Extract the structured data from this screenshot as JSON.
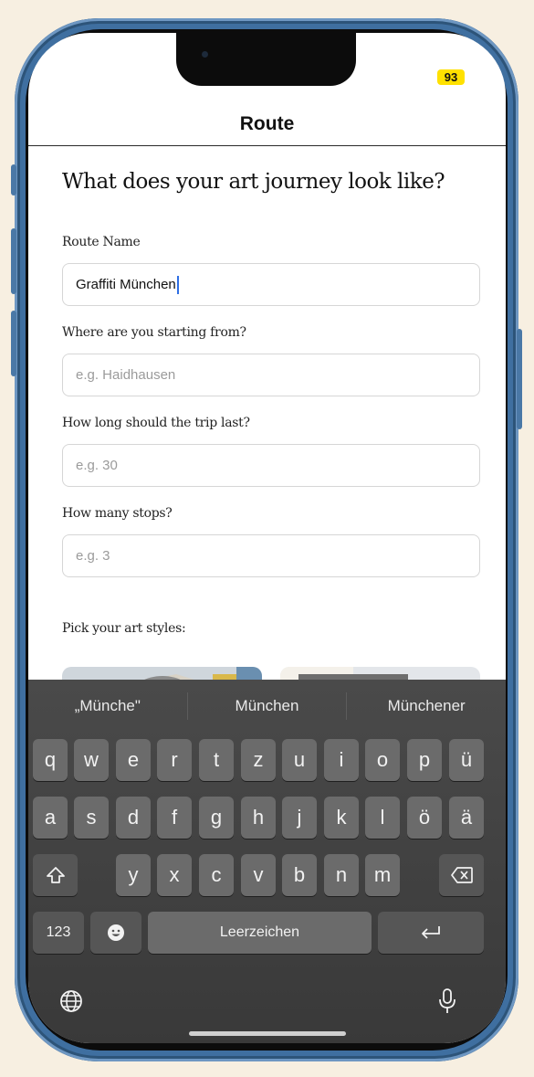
{
  "status": {
    "battery": "93"
  },
  "nav": {
    "title": "Route"
  },
  "form": {
    "heading": "What does your art journey look like?",
    "route_name": {
      "label": "Route Name",
      "value": "Graffiti München"
    },
    "start": {
      "label": "Where are you starting from?",
      "placeholder": "e.g. Haidhausen"
    },
    "duration": {
      "label": "How long should the trip last?",
      "placeholder": "e.g. 30"
    },
    "stops": {
      "label": "How many stops?",
      "placeholder": "e.g. 3"
    },
    "styles_label": "Pick your art styles:"
  },
  "keyboard": {
    "suggestions": [
      "„Münche\"",
      "München",
      "Münchener"
    ],
    "row1": [
      "q",
      "w",
      "e",
      "r",
      "t",
      "z",
      "u",
      "i",
      "o",
      "p",
      "ü"
    ],
    "row2": [
      "a",
      "s",
      "d",
      "f",
      "g",
      "h",
      "j",
      "k",
      "l",
      "ö",
      "ä"
    ],
    "row3": [
      "y",
      "x",
      "c",
      "v",
      "b",
      "n",
      "m"
    ],
    "numbers_label": "123",
    "space_label": "Leerzeichen",
    "icons": {
      "shift": "shift-icon",
      "delete": "delete-icon",
      "emoji": "emoji-icon",
      "return": "return-icon",
      "globe": "globe-icon",
      "mic": "microphone-icon"
    }
  },
  "colors": {
    "frame": "#3f6fa0",
    "battery_badge": "#ffe100",
    "caret": "#2f6fe4",
    "keyboard_bg": "#424242"
  }
}
